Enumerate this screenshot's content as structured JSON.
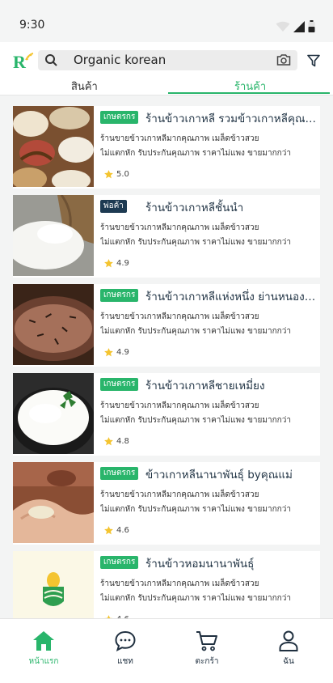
{
  "status_bar": {
    "time": "9:30"
  },
  "header": {
    "search_value": "Organic korean",
    "tabs": [
      {
        "label": "สินค้า",
        "active": false
      },
      {
        "label": "ร้านค้า",
        "active": true
      }
    ]
  },
  "stores": [
    {
      "badge": "เกษตรกร",
      "badge_type": "farmer",
      "name": "ร้านข้าวเกาหลี รวมข้าวเกาหลีคุณภาพ",
      "desc_line1": "ร้านขายข้าวเกาหลีมากคุณภาพ เมล็ดข้าวสวย",
      "desc_line2": "ไม่แตกหัก  รับประกันคุณภาพ ราคาไม่แพง ขายมากกว่า",
      "rating": "5.0",
      "image": "rice-sacks"
    },
    {
      "badge": "พ่อค้า",
      "badge_type": "trader",
      "name": "ร้านข้าวเกาหลีชั้นนำ",
      "desc_line1": "ร้านขายข้าวเกาหลีมากคุณภาพ เมล็ดข้าวสวย",
      "desc_line2": "ไม่แตกหัก  รับประกันคุณภาพ ราคาไม่แพง ขายมากกว่า",
      "rating": "4.9",
      "image": "white-rice-spill"
    },
    {
      "badge": "เกษตรกร",
      "badge_type": "farmer",
      "name": "ร้านข้าวเกาหลีแห่งหนึ่ง ย่านหนองแขม",
      "desc_line1": "ร้านขายข้าวเกาหลีมากคุณภาพ เมล็ดข้าวสวย",
      "desc_line2": "ไม่แตกหัก  รับประกันคุณภาพ ราคาไม่แพง ขายมากกว่า",
      "rating": "4.9",
      "image": "wild-rice"
    },
    {
      "badge": "เกษตรกร",
      "badge_type": "farmer",
      "name": "ร้านข้าวเกาหลีชายเหมี่ยง",
      "desc_line1": "ร้านขายข้าวเกาหลีมากคุณภาพ เมล็ดข้าวสวย",
      "desc_line2": "ไม่แตกหัก  รับประกันคุณภาพ ราคาไม่แพง ขายมากกว่า",
      "rating": "4.8",
      "image": "cooked-rice-bowl"
    },
    {
      "badge": "เกษตรกร",
      "badge_type": "farmer",
      "name": "ข้าวเกาหลีนานาพันธุ์ byคุณแม่",
      "desc_line1": "ร้านขายข้าวเกาหลีมากคุณภาพ เมล็ดข้าวสวย",
      "desc_line2": "ไม่แตกหัก  รับประกันคุณภาพ ราคาไม่แพง ขายมากกว่า",
      "rating": "4.6",
      "image": "rice-in-hands"
    },
    {
      "badge": "เกษตรกร",
      "badge_type": "farmer",
      "name": "ร้านข้าวหอมนานาพันธุ์",
      "desc_line1": "ร้านขายข้าวเกาหลีมากคุณภาพ เมล็ดข้าวสวย",
      "desc_line2": "ไม่แตกหัก  รับประกันคุณภาพ ราคาไม่แพง ขายมากกว่า",
      "rating": "4.6",
      "image": "rice-logo"
    }
  ],
  "bottom_nav": [
    {
      "label": "หน้าแรก",
      "icon": "home-icon",
      "active": true
    },
    {
      "label": "แชท",
      "icon": "chat-icon",
      "active": false
    },
    {
      "label": "ตะกร้า",
      "icon": "cart-icon",
      "active": false
    },
    {
      "label": "ฉัน",
      "icon": "user-icon",
      "active": false
    }
  ],
  "colors": {
    "accent": "#29b56b",
    "trader_badge": "#1d3a52",
    "title_text": "#1f3243",
    "star": "#f4c430"
  }
}
